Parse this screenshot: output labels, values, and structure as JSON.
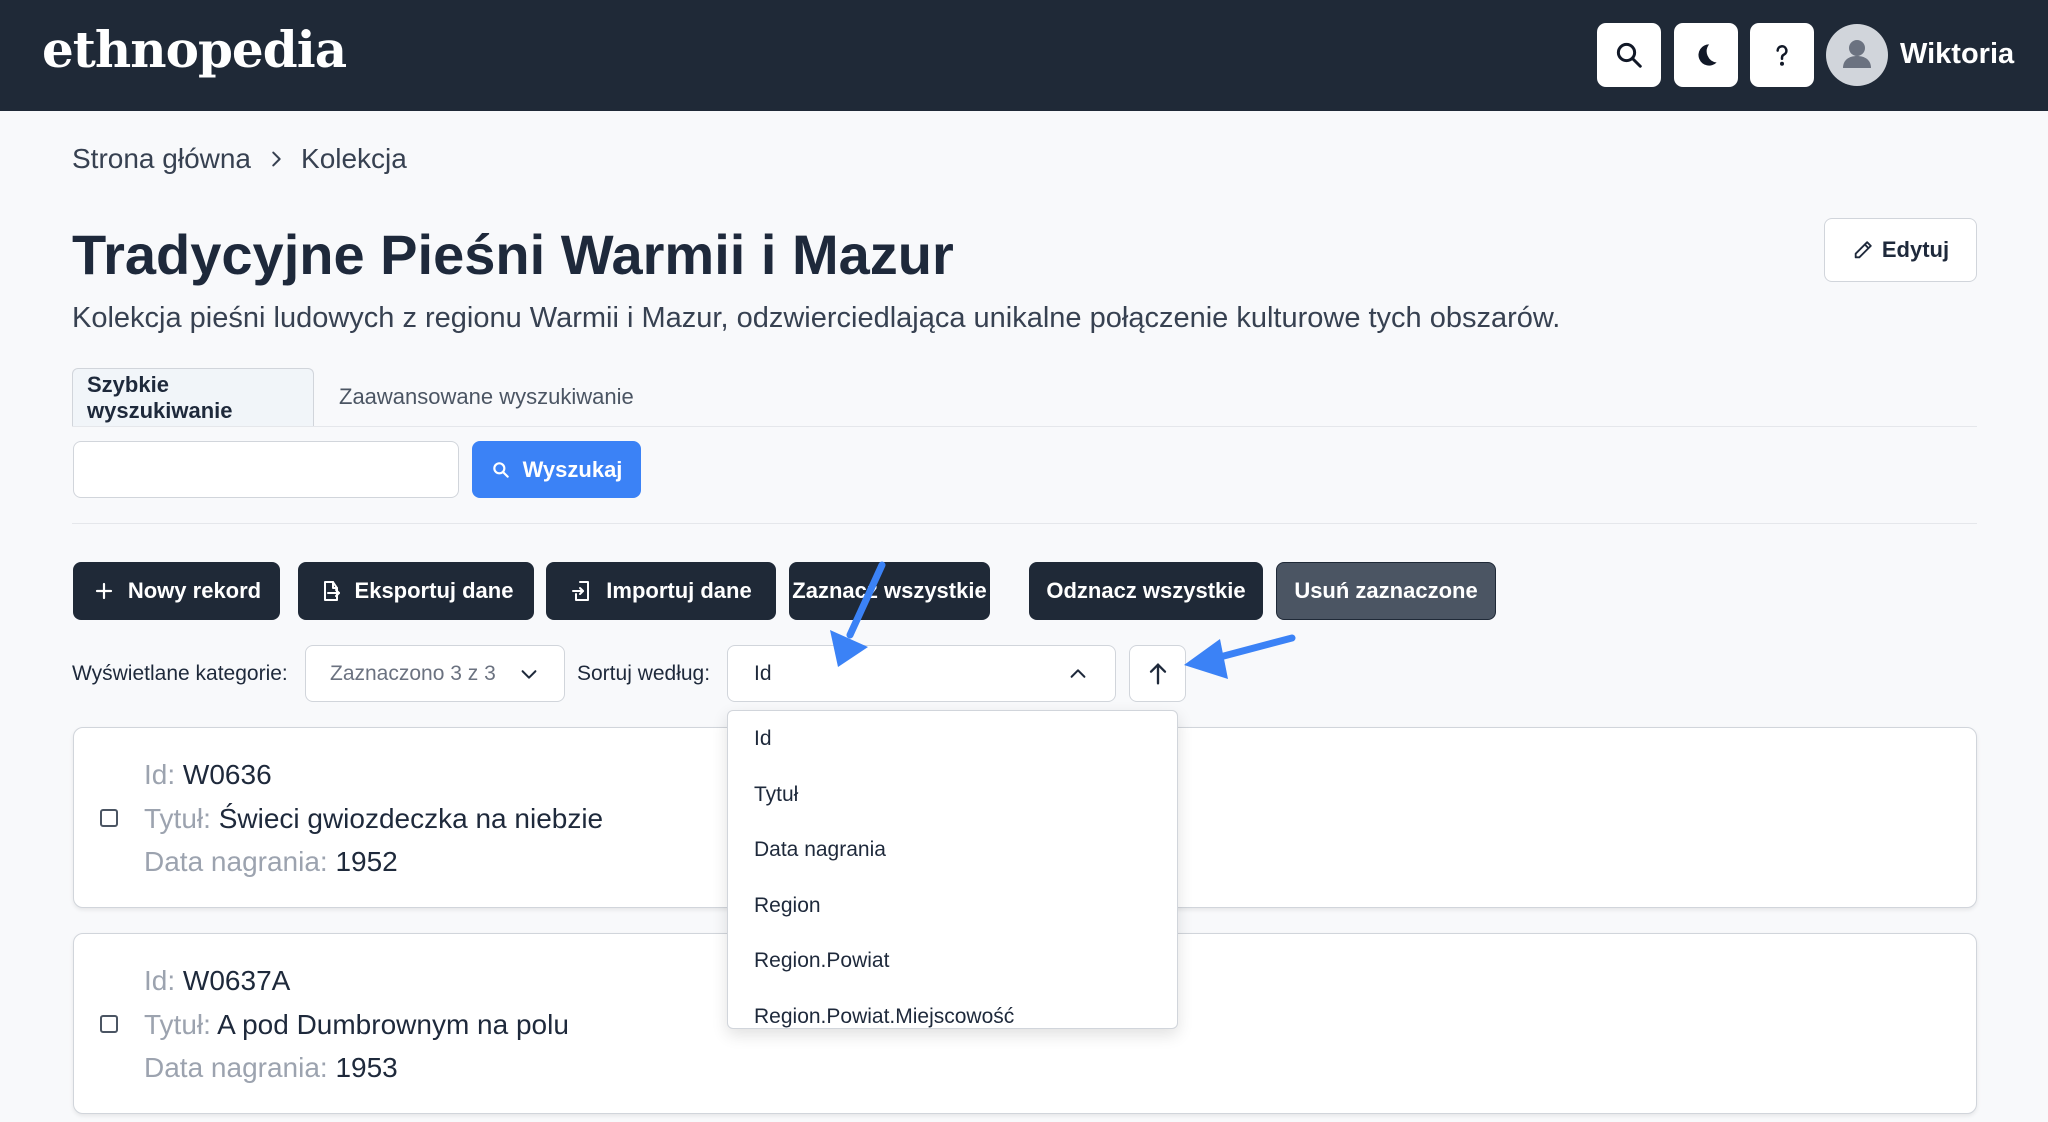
{
  "header": {
    "logo": "ethnopedia",
    "user_name": "Wiktoria",
    "icons": [
      "search-icon",
      "moon-icon",
      "help-icon",
      "avatar-icon"
    ]
  },
  "breadcrumb": {
    "home": "Strona główna",
    "current": "Kolekcja"
  },
  "page": {
    "title": "Tradycyjne Pieśni Warmii i Mazur",
    "description": "Kolekcja pieśni ludowych z regionu Warmii i Mazur, odzwierciedlająca unikalne połączenie kulturowe tych obszarów.",
    "edit_label": "Edytuj"
  },
  "tabs": {
    "quick": "Szybkie wyszukiwanie",
    "advanced": "Zaawansowane wyszukiwanie"
  },
  "search": {
    "value": "",
    "button_label": "Wyszukaj"
  },
  "actions": {
    "new_record": "Nowy rekord",
    "export": "Eksportuj dane",
    "import": "Importuj dane",
    "select_all": "Zaznacz wszystkie",
    "deselect_all": "Odznacz wszystkie",
    "delete_selected": "Usuń zaznaczone"
  },
  "filters": {
    "categories_label": "Wyświetlane kategorie:",
    "categories_value": "Zaznaczono 3 z 3",
    "sort_label": "Sortuj według:",
    "sort_value": "Id",
    "sort_options": [
      "Id",
      "Tytuł",
      "Data nagrania",
      "Region",
      "Region.Powiat",
      "Region.Powiat.Miejscowość"
    ]
  },
  "records": [
    {
      "id_label": "Id:",
      "id": "W0636",
      "title_label": "Tytuł:",
      "title": "Świeci gwiozdeczka na niebzie",
      "date_label": "Data nagrania:",
      "date": "1952"
    },
    {
      "id_label": "Id:",
      "id": "W0637A",
      "title_label": "Tytuł:",
      "title": "A pod Dumbrownym na polu",
      "date_label": "Data nagrania:",
      "date": "1953"
    }
  ],
  "colors": {
    "header_bg": "#1f2937",
    "primary": "#3b82f6",
    "dark_button": "#1f2937",
    "annotation_arrow": "#3b82f6"
  }
}
